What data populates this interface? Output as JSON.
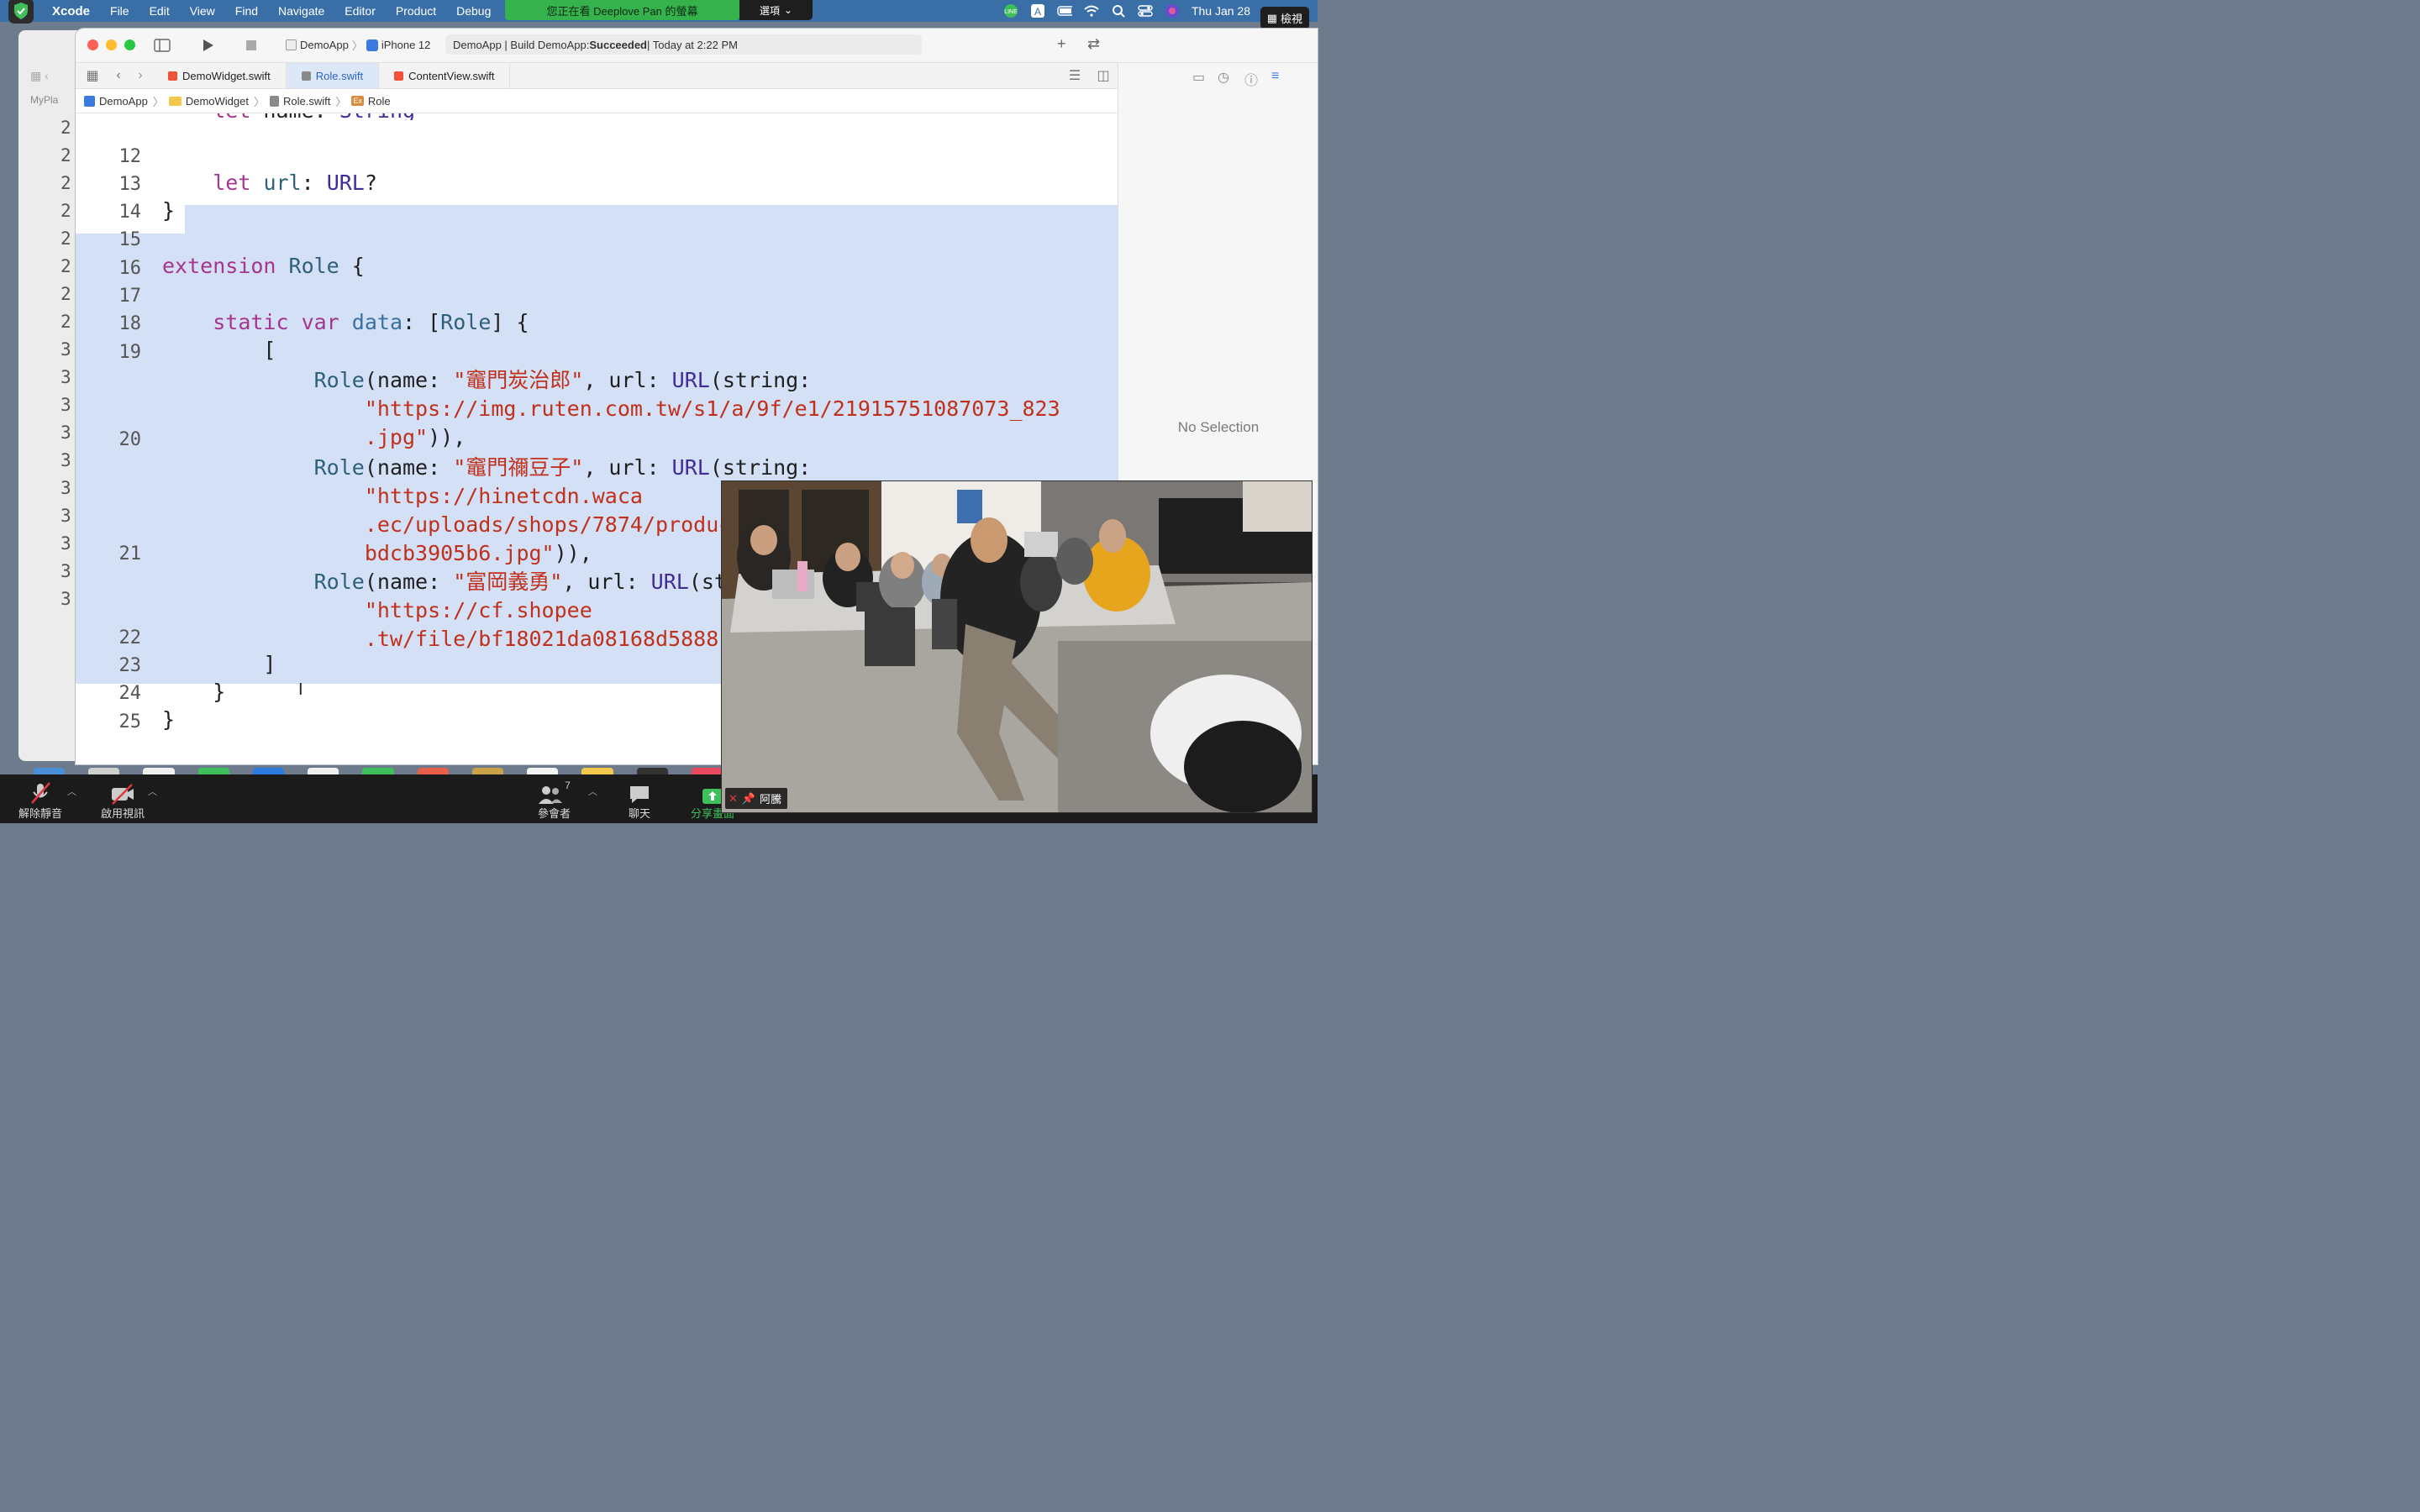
{
  "menubar": {
    "app": "Xcode",
    "items": [
      "File",
      "Edit",
      "View",
      "Find",
      "Navigate",
      "Editor",
      "Product",
      "Debug"
    ],
    "share_banner": "您正在看 Deeplove Pan 的螢幕",
    "share_options": "選項",
    "clock": "Thu Jan 28",
    "view_button": "檢視",
    "status_icons": [
      "line-icon",
      "input-source-icon",
      "battery-icon",
      "wifi-icon",
      "spotlight-icon",
      "control-center-icon",
      "siri-icon"
    ]
  },
  "toolbar": {
    "scheme": "DemoApp",
    "device": "iPhone 12",
    "activity_prefix": "DemoApp | Build DemoApp: ",
    "activity_status": "Succeeded",
    "activity_suffix": " | Today at 2:22 PM"
  },
  "tabs": [
    {
      "label": "DemoWidget.swift",
      "active": false
    },
    {
      "label": "Role.swift",
      "active": true
    },
    {
      "label": "ContentView.swift",
      "active": false
    }
  ],
  "jumpbar": {
    "project": "DemoApp",
    "folder": "DemoWidget",
    "file": "Role.swift",
    "symbol": "Role",
    "symbol_badge": "Ex"
  },
  "inspector": {
    "empty_text": "No Selection"
  },
  "editor": {
    "line_numbers": [
      "12",
      "13",
      "14",
      "15",
      "16",
      "17",
      "18",
      "19",
      "20",
      "21",
      "22",
      "23",
      "24",
      "25"
    ],
    "partial_top_line": "let name: String",
    "selection": "lines 15-24"
  },
  "background_window": {
    "tab_label": "MyPla",
    "line_numbers": [
      "2",
      "2",
      "2",
      "2",
      "2",
      "2",
      "2",
      "2",
      "3",
      "3",
      "3",
      "3",
      "3",
      "3",
      "3",
      "3",
      "3",
      "3"
    ]
  },
  "zoom": {
    "unmute": "解除靜音",
    "start_video": "啟用視訊",
    "participants": "參會者",
    "participant_count": "7",
    "chat": "聊天",
    "share_screen": "分享畫面",
    "video_name": "阿騰"
  },
  "colors": {
    "menubar": "#3a6ea7",
    "share_banner": "#36b24d",
    "selection": "#d3e0f5",
    "keyword": "#a5358e",
    "string": "#c0301b",
    "type": "#2f5f7a"
  }
}
